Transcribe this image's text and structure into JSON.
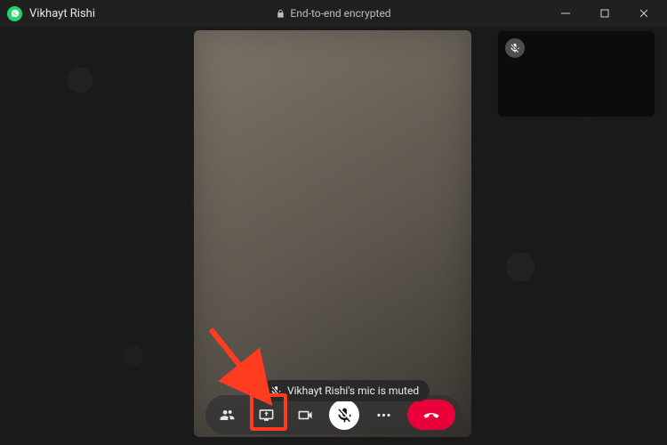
{
  "header": {
    "contact_name": "Vikhayt Rishi",
    "encryption_label": "End-to-end encrypted"
  },
  "toast": {
    "message": "Vikhayt Rishi's mic is muted"
  },
  "controls": {
    "participants": "participants",
    "screen_share": "screen-share",
    "video": "video",
    "mic": "mic",
    "more": "more",
    "end_call": "end-call"
  },
  "colors": {
    "accent_green": "#25d366",
    "end_call_red": "#ea0038",
    "highlight_red": "#ff3b20"
  }
}
